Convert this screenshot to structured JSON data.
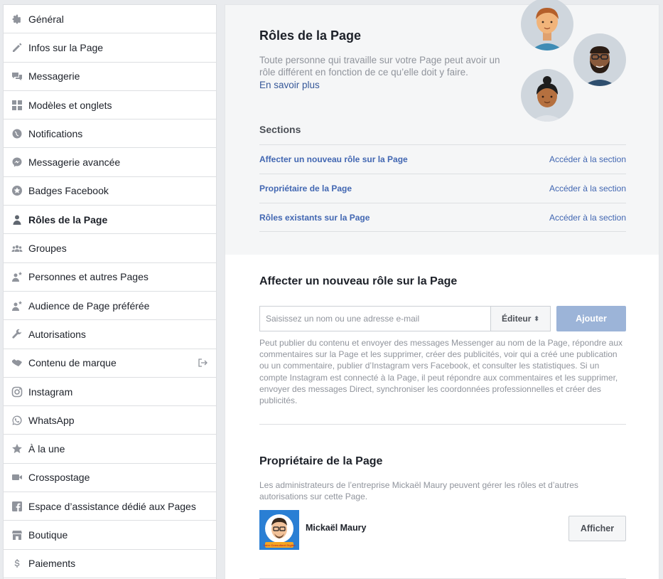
{
  "sidebar": {
    "items": [
      {
        "label": "Général",
        "icon": "gear-icon"
      },
      {
        "label": "Infos sur la Page",
        "icon": "pencil-icon"
      },
      {
        "label": "Messagerie",
        "icon": "chat-bubbles-icon"
      },
      {
        "label": "Modèles et onglets",
        "icon": "grid-icon"
      },
      {
        "label": "Notifications",
        "icon": "globe-icon"
      },
      {
        "label": "Messagerie avancée",
        "icon": "messenger-icon"
      },
      {
        "label": "Badges Facebook",
        "icon": "star-badge-icon"
      },
      {
        "label": "Rôles de la Page",
        "icon": "person-icon",
        "active": true
      },
      {
        "label": "Groupes",
        "icon": "group-icon"
      },
      {
        "label": "Personnes et autres Pages",
        "icon": "person-star-icon"
      },
      {
        "label": "Audience de Page préférée",
        "icon": "person-star-icon"
      },
      {
        "label": "Autorisations",
        "icon": "wrench-icon"
      },
      {
        "label": "Contenu de marque",
        "icon": "handshake-icon"
      },
      {
        "label": "Instagram",
        "icon": "instagram-icon"
      },
      {
        "label": "WhatsApp",
        "icon": "whatsapp-icon"
      },
      {
        "label": "À la une",
        "icon": "star-icon"
      },
      {
        "label": "Crosspostage",
        "icon": "video-camera-icon"
      },
      {
        "label": "Espace d’assistance dédié aux Pages",
        "icon": "facebook-icon"
      },
      {
        "label": "Boutique",
        "icon": "shop-icon"
      },
      {
        "label": "Paiements",
        "icon": "dollar-icon"
      }
    ]
  },
  "roles": {
    "title": "Rôles de la Page",
    "intro": "Toute personne qui travaille sur votre Page peut avoir un rôle différent en fonction de ce qu’elle doit y faire.",
    "learn_more": "En savoir plus",
    "sections_heading": "Sections",
    "sections": [
      {
        "label": "Affecter un nouveau rôle sur la Page",
        "action": "Accéder à la section"
      },
      {
        "label": "Propriétaire de la Page",
        "action": "Accéder à la section"
      },
      {
        "label": "Rôles existants sur la Page",
        "action": "Accéder à la section"
      }
    ]
  },
  "assign": {
    "title": "Affecter un nouveau rôle sur la Page",
    "input_placeholder": "Saisissez un nom ou une adresse e-mail",
    "role_value": "Éditeur",
    "add_label": "Ajouter",
    "help": "Peut publier du contenu et envoyer des messages Messenger au nom de la Page, répondre aux commentaires sur la Page et les supprimer, créer des publicités, voir qui a créé une publication ou un commentaire, publier d’Instagram vers Facebook, et consulter les statistiques. Si un compte Instagram est connecté à la Page, il peut répondre aux commentaires et les supprimer, envoyer des messages Direct, synchroniser les coordonnées professionnelles et créer des publicités."
  },
  "owner": {
    "title": "Propriétaire de la Page",
    "description": "Les administrateurs de l’entreprise Mickaël Maury peuvent gérer les rôles et d’autres autorisations sur cette Page.",
    "name": "Mickaël Maury",
    "show_label": "Afficher",
    "avatar_caption": "Votre Consultant Digital"
  }
}
